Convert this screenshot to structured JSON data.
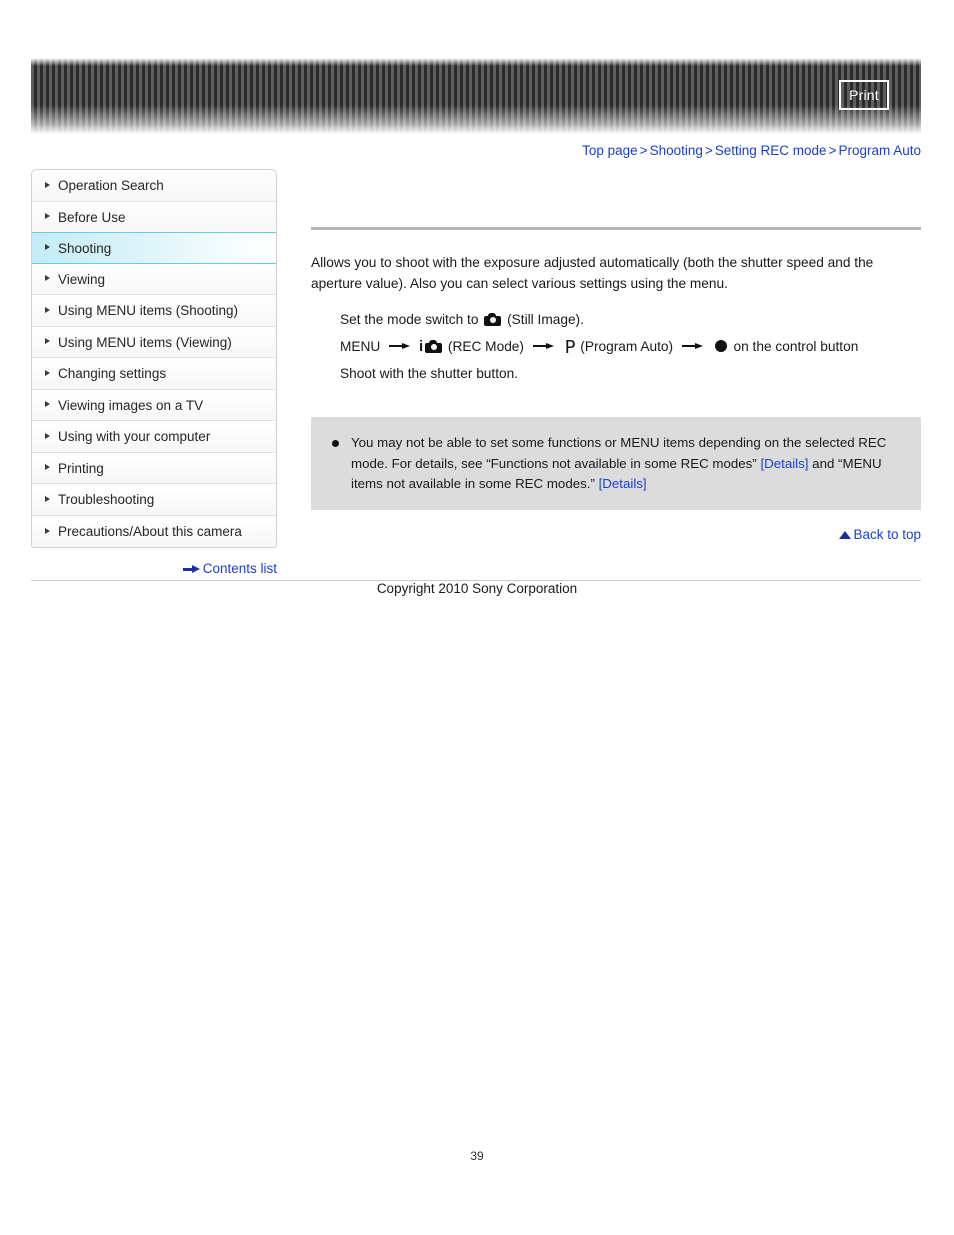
{
  "header": {
    "print_label": "Print"
  },
  "breadcrumb": {
    "separator": ">",
    "items": [
      {
        "label": "Top page"
      },
      {
        "label": "Shooting"
      },
      {
        "label": "Setting REC mode"
      },
      {
        "label": "Program Auto"
      }
    ]
  },
  "sidebar": {
    "items": [
      {
        "label": "Operation Search",
        "active": false
      },
      {
        "label": "Before Use",
        "active": false
      },
      {
        "label": "Shooting",
        "active": true
      },
      {
        "label": "Viewing",
        "active": false
      },
      {
        "label": "Using MENU items (Shooting)",
        "active": false
      },
      {
        "label": "Using MENU items (Viewing)",
        "active": false
      },
      {
        "label": "Changing settings",
        "active": false
      },
      {
        "label": "Viewing images on a TV",
        "active": false
      },
      {
        "label": "Using with your computer",
        "active": false
      },
      {
        "label": "Printing",
        "active": false
      },
      {
        "label": "Troubleshooting",
        "active": false
      },
      {
        "label": "Precautions/About this camera",
        "active": false
      }
    ],
    "contents_list_label": "Contents list"
  },
  "main": {
    "lead_paragraph": "Allows you to shoot with the exposure adjusted automatically (both the shutter speed and the aperture value). Also you can select various settings using the menu.",
    "step1_prefix": "Set the mode switch to",
    "step1_suffix": "(Still Image).",
    "step2_menu": "MENU",
    "step2_rec_mode": "(REC Mode)",
    "step2_p_symbol": "P",
    "step2_program_auto": "(Program Auto)",
    "step2_control_button": "on the control button",
    "step3": "Shoot with the shutter button.",
    "note": {
      "text_part1": "You may not be able to set some functions or MENU items depending on the selected REC mode. For details, see “Functions not available in some REC modes” ",
      "link1": "[Details]",
      "text_part2": " and “MENU items not available in some REC modes.” ",
      "link2": "[Details]"
    },
    "back_to_top_label": "Back to top"
  },
  "footer": {
    "copyright": "Copyright 2010 Sony Corporation",
    "page_number": "39"
  }
}
